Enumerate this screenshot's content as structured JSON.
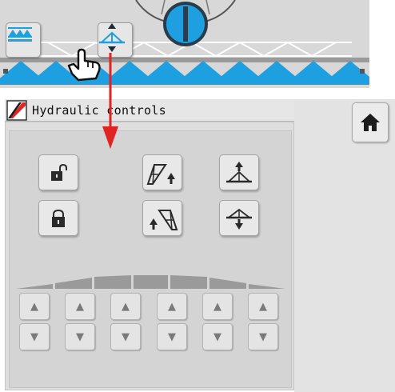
{
  "screen": {
    "title": "Hydraulic controls"
  },
  "colors": {
    "nozzle_blue": "#1e9fe0",
    "arrow_red": "#e02323",
    "boom_section": "#9a9a9a"
  },
  "overview": {
    "boom_sections_count": 10,
    "buttons": [
      {
        "icon": "boom-sections-icon"
      },
      {
        "icon": "boom-height-icon",
        "state": "pressed"
      }
    ]
  },
  "controls": {
    "row1": [
      {
        "icon": "unlock-icon"
      },
      {
        "icon": "fold-boom-left-up-icon"
      },
      {
        "icon": "boom-raise-icon"
      }
    ],
    "row2": [
      {
        "icon": "lock-icon"
      },
      {
        "icon": "fold-boom-right-up-icon"
      },
      {
        "icon": "boom-lower-icon"
      }
    ]
  },
  "sections": {
    "count": 6,
    "up_glyph": "▲",
    "down_glyph": "▼"
  },
  "home": {
    "icon": "home-icon"
  }
}
